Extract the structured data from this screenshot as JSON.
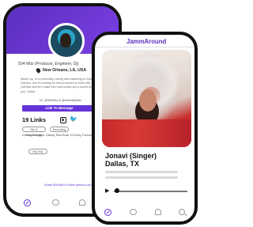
{
  "back_profile": {
    "name_line": "504 Mitz (Producer, Engineer, Dj)",
    "location": "New Orleans, LA, USA",
    "bio": "What's up, I'm a recording, mixing and mastering en Instagram. New Orleans, and I'm looking for new producers to work with. Send me y'all files and let's make them and create you a sound that defines you. Follow",
    "handles": "IG: @504Mitz & @Mixed8yMitz",
    "message_button": "Link To Message",
    "links_count": "19 Links",
    "skills": [
      "Mix & Engineering",
      "Recording"
    ],
    "credits": "Credits: Fungkins, Calboy, Rick Ross, DJ Envy, Forever Holl",
    "genre_chip": "Hip Hop",
    "share_link": "Share 504Mitz's Profile jamma.com",
    "accent": "#6534d8"
  },
  "front_profile": {
    "brand": "JammAround",
    "performer_name": "Jonavi (Singer)",
    "performer_location": "Dallas, TX"
  },
  "icons": [
    "compass-icon",
    "chat-bubble-icon",
    "bell-icon",
    "search-icon",
    "play-icon",
    "instagram-icon",
    "twitter-icon",
    "location-pin-icon"
  ]
}
